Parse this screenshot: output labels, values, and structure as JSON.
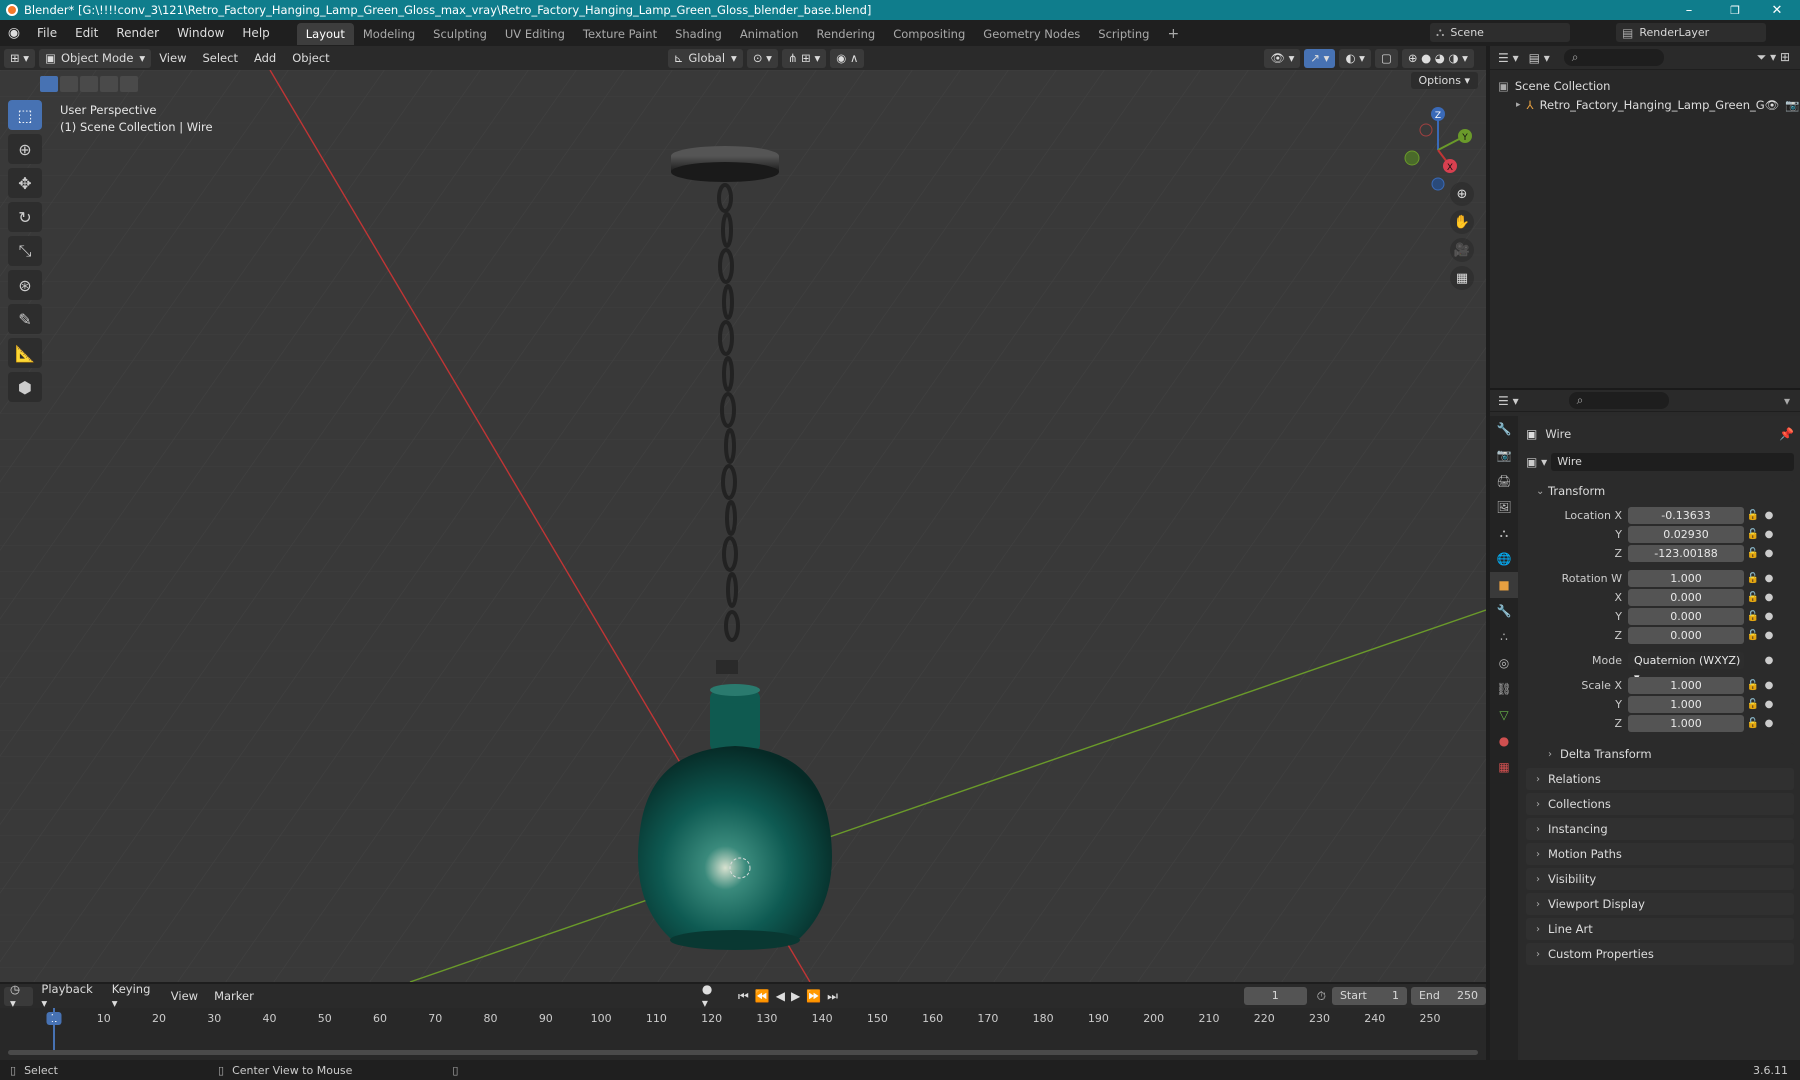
{
  "window": {
    "title": "Blender* [G:\\!!!!conv_3\\121\\Retro_Factory_Hanging_Lamp_Green_Gloss_max_vray\\Retro_Factory_Hanging_Lamp_Green_Gloss_blender_base.blend]",
    "minimize": "–",
    "maximize": "❐",
    "close": "✕"
  },
  "menubar": {
    "items": [
      "File",
      "Edit",
      "Render",
      "Window",
      "Help"
    ],
    "workspaces": [
      "Layout",
      "Modeling",
      "Sculpting",
      "UV Editing",
      "Texture Paint",
      "Shading",
      "Animation",
      "Rendering",
      "Compositing",
      "Geometry Nodes",
      "Scripting"
    ],
    "active_workspace": "Layout",
    "add_workspace": "+",
    "scene": "Scene",
    "render_layer": "RenderLayer"
  },
  "viewport_header": {
    "mode": "Object Mode",
    "menus": [
      "View",
      "Select",
      "Add",
      "Object"
    ],
    "orientation": "Global",
    "options": "Options"
  },
  "viewport": {
    "perspective": "User Perspective",
    "collection_info": "(1) Scene Collection | Wire",
    "gizmo": {
      "x": "X",
      "y": "Y",
      "z": "Z"
    }
  },
  "outliner": {
    "root": "Scene Collection",
    "items": [
      "Retro_Factory_Hanging_Lamp_Green_G"
    ]
  },
  "properties": {
    "object_name": "Wire",
    "data_name": "Wire",
    "transform_title": "Transform",
    "location_label": "Location X",
    "location": [
      "-0.13633",
      "0.02930",
      "-123.00188"
    ],
    "rotation_label": "Rotation W",
    "rotation": [
      "1.000",
      "0.000",
      "0.000",
      "0.000"
    ],
    "mode_label": "Mode",
    "mode_value": "Quaternion (WXYZ)",
    "scale_label": "Scale X",
    "scale": [
      "1.000",
      "1.000",
      "1.000"
    ],
    "axis_labels": [
      "Y",
      "Z",
      "X"
    ],
    "delta_transform": "Delta Transform",
    "sections": [
      "Relations",
      "Collections",
      "Instancing",
      "Motion Paths",
      "Visibility",
      "Viewport Display",
      "Line Art",
      "Custom Properties"
    ]
  },
  "timeline": {
    "menus": [
      "Playback",
      "Keying",
      "View",
      "Marker"
    ],
    "current_frame": "1",
    "start_label": "Start",
    "start": "1",
    "end_label": "End",
    "end": "250",
    "ticks": [
      "1",
      "10",
      "20",
      "30",
      "40",
      "50",
      "60",
      "70",
      "80",
      "90",
      "100",
      "110",
      "120",
      "130",
      "140",
      "150",
      "160",
      "170",
      "180",
      "190",
      "200",
      "210",
      "220",
      "230",
      "240",
      "250"
    ]
  },
  "statusbar": {
    "left": "Select",
    "middle": "Center View to Mouse",
    "version": "3.6.11"
  },
  "colors": {
    "titlebar": "#0f7d8c",
    "active_blue": "#4772b3",
    "x_axis": "#c03535",
    "y_axis": "#6a9a2a",
    "lamp": "#0e5a52"
  }
}
